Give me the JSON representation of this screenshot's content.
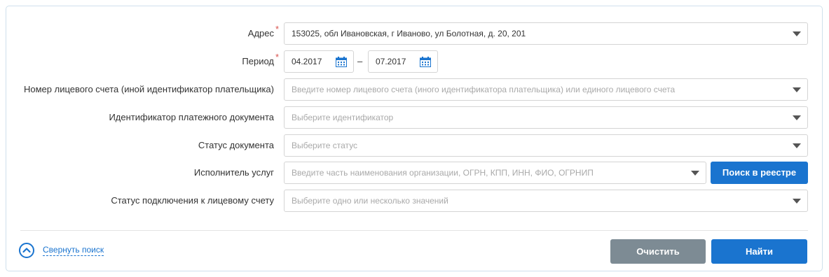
{
  "form": {
    "address": {
      "label": "Адрес",
      "required_mark": "*",
      "value": "153025, обл Ивановская, г Иваново, ул Болотная, д. 20, 201"
    },
    "period": {
      "label": "Период",
      "required_mark": "*",
      "from": "04.2017",
      "separator": "–",
      "to": "07.2017"
    },
    "account_number": {
      "label": "Номер лицевого счета (иной идентификатор плательщика)",
      "placeholder": "Введите номер лицевого счета (иного идентификатора плательщика) или единого лицевого счета"
    },
    "payment_doc_id": {
      "label": "Идентификатор платежного документа",
      "placeholder": "Выберите идентификатор"
    },
    "doc_status": {
      "label": "Статус документа",
      "placeholder": "Выберите статус"
    },
    "service_provider": {
      "label": "Исполнитель услуг",
      "placeholder": "Введите часть наименования организации, ОГРН, КПП, ИНН, ФИО, ОГРНИП",
      "registry_button": "Поиск в реестре"
    },
    "connection_status": {
      "label": "Статус подключения к лицевому счету",
      "placeholder": "Выберите одно или несколько значений"
    }
  },
  "footer": {
    "collapse_label": "Свернуть поиск",
    "clear_button": "Очистить",
    "find_button": "Найти"
  },
  "colors": {
    "primary": "#1a74cf",
    "secondary_button": "#7d8b94",
    "required": "#d9534f",
    "placeholder": "#a9a9a9"
  },
  "icons": {
    "dropdown": "chevron-down-icon",
    "calendar": "calendar-icon",
    "collapse": "chevron-up-circle-icon"
  }
}
